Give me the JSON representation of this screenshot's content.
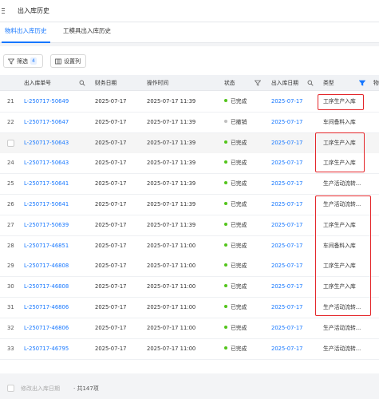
{
  "page": {
    "title": "出入库历史"
  },
  "tabs": [
    {
      "label": "物料出入库历史",
      "active": true
    },
    {
      "label": "工模具出入库历史",
      "active": false
    }
  ],
  "toolbar": {
    "filter_label": "筛选",
    "filter_count": "4",
    "settings_label": "设置列"
  },
  "table": {
    "headers": [
      "出入库单号",
      "财务日期",
      "操作时间",
      "状态",
      "出入库日期",
      "类型",
      "物"
    ],
    "rows": [
      {
        "index": "21",
        "order_no": "L-250717-50649",
        "finance_date": "2025-07-17",
        "op_time": "2025-07-17 11:39",
        "status": "已完成",
        "io_date": "2025-07-17",
        "type": "工序生产入库",
        "highlighted": false
      },
      {
        "index": "22",
        "order_no": "L-250717-50647",
        "finance_date": "2025-07-17",
        "op_time": "2025-07-17 11:39",
        "status": "已撤销",
        "io_date": "2025-07-17",
        "type": "车间备料入库",
        "highlighted": false
      },
      {
        "index": "",
        "order_no": "L-250717-50643",
        "finance_date": "2025-07-17",
        "op_time": "2025-07-17 11:39",
        "status": "已完成",
        "io_date": "2025-07-17",
        "type": "工序生产入库",
        "highlighted": true
      },
      {
        "index": "24",
        "order_no": "L-250717-50643",
        "finance_date": "2025-07-17",
        "op_time": "2025-07-17 11:39",
        "status": "已完成",
        "io_date": "2025-07-17",
        "type": "工序生产入库",
        "highlighted": false
      },
      {
        "index": "25",
        "order_no": "L-250717-50641",
        "finance_date": "2025-07-17",
        "op_time": "2025-07-17 11:39",
        "status": "已完成",
        "io_date": "2025-07-17",
        "type": "生产活动流转...",
        "highlighted": false
      },
      {
        "index": "26",
        "order_no": "L-250717-50641",
        "finance_date": "2025-07-17",
        "op_time": "2025-07-17 11:39",
        "status": "已完成",
        "io_date": "2025-07-17",
        "type": "生产活动流转...",
        "highlighted": false
      },
      {
        "index": "27",
        "order_no": "L-250717-50639",
        "finance_date": "2025-07-17",
        "op_time": "2025-07-17 11:39",
        "status": "已完成",
        "io_date": "2025-07-17",
        "type": "工序生产入库",
        "highlighted": false
      },
      {
        "index": "28",
        "order_no": "L-250717-46851",
        "finance_date": "2025-07-17",
        "op_time": "2025-07-17 11:00",
        "status": "已完成",
        "io_date": "2025-07-17",
        "type": "车间备料入库",
        "highlighted": false
      },
      {
        "index": "29",
        "order_no": "L-250717-46808",
        "finance_date": "2025-07-17",
        "op_time": "2025-07-17 11:00",
        "status": "已完成",
        "io_date": "2025-07-17",
        "type": "工序生产入库",
        "highlighted": false
      },
      {
        "index": "30",
        "order_no": "L-250717-46808",
        "finance_date": "2025-07-17",
        "op_time": "2025-07-17 11:00",
        "status": "已完成",
        "io_date": "2025-07-17",
        "type": "工序生产入库",
        "highlighted": false
      },
      {
        "index": "31",
        "order_no": "L-250717-46806",
        "finance_date": "2025-07-17",
        "op_time": "2025-07-17 11:00",
        "status": "已完成",
        "io_date": "2025-07-17",
        "type": "生产活动流转...",
        "highlighted": false
      },
      {
        "index": "32",
        "order_no": "L-250717-46806",
        "finance_date": "2025-07-17",
        "op_time": "2025-07-17 11:00",
        "status": "已完成",
        "io_date": "2025-07-17",
        "type": "生产活动流转...",
        "highlighted": false
      },
      {
        "index": "33",
        "order_no": "L-250717-46795",
        "finance_date": "2025-07-17",
        "op_time": "2025-07-17 11:00",
        "status": "已完成",
        "io_date": "2025-07-17",
        "type": "生产活动流转...",
        "highlighted": false
      }
    ]
  },
  "footer": {
    "modify_date_label": "修改出入库日期",
    "total_text": "· 共147项"
  },
  "colors": {
    "accent": "#1677ff",
    "status_done": "#52c41a",
    "status_cancelled": "#bfbfbf",
    "annotation_red": "#e4262a"
  }
}
